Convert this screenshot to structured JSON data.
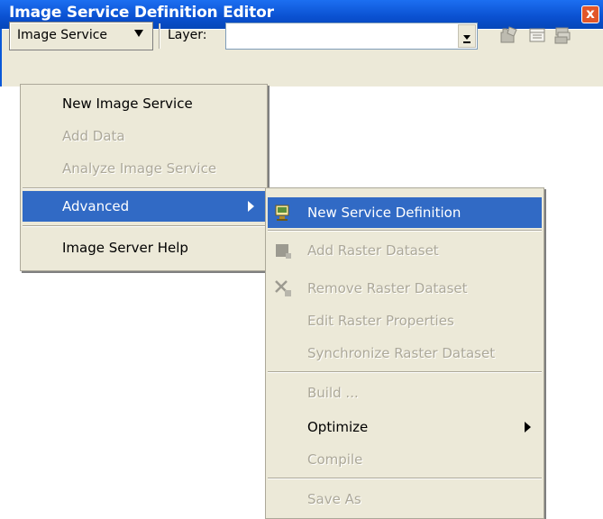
{
  "window": {
    "title": "Image Service Definition Editor",
    "close_glyph": "x"
  },
  "toolbar": {
    "service_label": "Image Service",
    "layer_label": "Layer:",
    "layer_value": "",
    "icons": [
      "folder-icon",
      "table-icon",
      "layers-icon"
    ]
  },
  "main_menu": {
    "items": [
      {
        "label": "New Image Service",
        "enabled": true
      },
      {
        "label": "Add Data",
        "enabled": false
      },
      {
        "label": "Analyze Image Service",
        "enabled": false
      },
      {
        "label": "Advanced",
        "enabled": true,
        "selected": true,
        "submenu": true
      },
      {
        "label": "Image Server Help",
        "enabled": true
      }
    ]
  },
  "advanced_menu": {
    "items": [
      {
        "label": "New Service Definition",
        "enabled": true,
        "selected": true,
        "icon": "service-definition-icon"
      },
      {
        "label": "Add Raster Dataset",
        "enabled": false,
        "icon": "add-raster-icon"
      },
      {
        "label": "Remove Raster Dataset",
        "enabled": false,
        "icon": "remove-raster-icon"
      },
      {
        "label": "Edit Raster Properties",
        "enabled": false
      },
      {
        "label": "Synchronize Raster Dataset",
        "enabled": false
      },
      {
        "label": "Build ...",
        "enabled": false
      },
      {
        "label": "Optimize",
        "enabled": true,
        "submenu": true
      },
      {
        "label": "Compile",
        "enabled": false
      },
      {
        "label": "Save As",
        "enabled": false
      }
    ]
  },
  "colors": {
    "titlebar": "#0a58d8",
    "menu_bg": "#ece9d8",
    "highlight": "#316ac5",
    "disabled_text": "#aca899"
  }
}
